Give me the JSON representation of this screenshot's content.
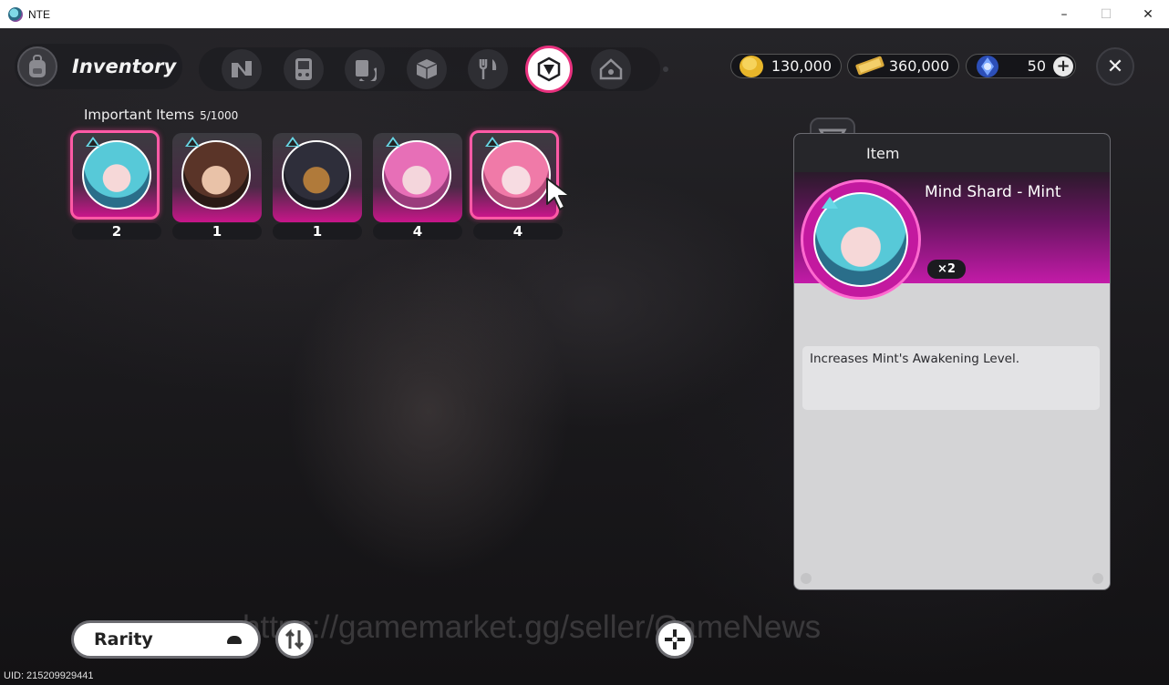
{
  "window": {
    "title": "NTE",
    "minimize": "–",
    "maximize": "☐",
    "close": "✕"
  },
  "header": {
    "title": "Inventory",
    "close_glyph": "✕"
  },
  "categories": [
    {
      "icon": "n-logo-icon"
    },
    {
      "icon": "handheld-console-icon"
    },
    {
      "icon": "cards-icon"
    },
    {
      "icon": "box-icon"
    },
    {
      "icon": "fork-knife-icon"
    },
    {
      "icon": "crystal-shard-icon",
      "active": true
    },
    {
      "icon": "home-icon"
    }
  ],
  "currencies": [
    {
      "icon": "gold-coin-icon",
      "value": "130,000"
    },
    {
      "icon": "ticket-icon",
      "value": "360,000"
    },
    {
      "icon": "blue-crystal-icon",
      "value": "50",
      "plus": "+"
    }
  ],
  "section": {
    "title": "Important Items",
    "count": "5/1000"
  },
  "items": [
    {
      "qty": "2",
      "portrait": "teal-hair-girl",
      "selected": true
    },
    {
      "qty": "1",
      "portrait": "brown-hair-man"
    },
    {
      "qty": "1",
      "portrait": "dog-creature"
    },
    {
      "qty": "4",
      "portrait": "pink-hair-girl"
    },
    {
      "qty": "4",
      "portrait": "pink-short-hair-girl",
      "selected": true
    }
  ],
  "detail": {
    "header_label": "Item",
    "name": "Mind Shard - Mint",
    "qty": "×2",
    "description": "Increases Mint's Awakening Level."
  },
  "bottom": {
    "sort_label": "Rarity",
    "watermark": "https://gamemarket.gg/seller/GameNews",
    "uid": "UID: 215209929441"
  },
  "colors": {
    "accent": "#e8317e",
    "item_glow": "#c8168a",
    "banner": "#c31ba8"
  }
}
